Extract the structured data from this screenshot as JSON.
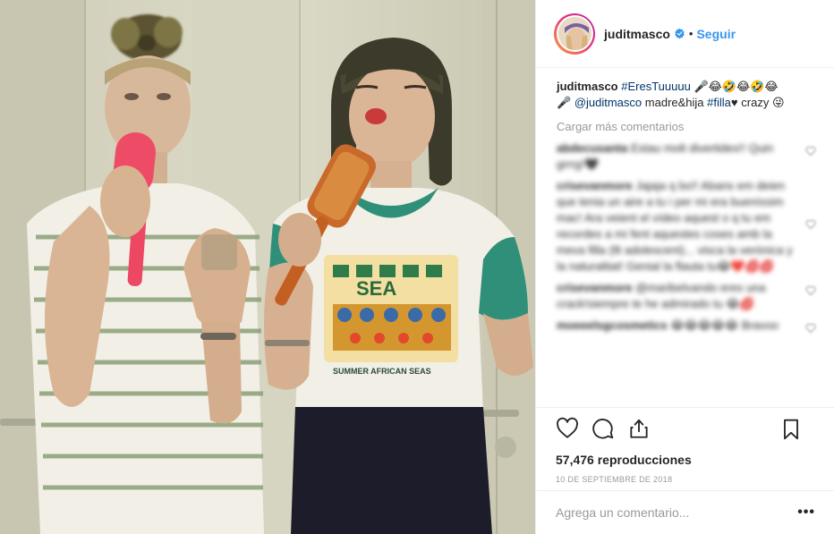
{
  "header": {
    "username": "juditmasco",
    "separator": "•",
    "follow_label": "Seguir",
    "verified_icon": "verified-badge-icon",
    "accent_color": "#3897f0"
  },
  "caption": {
    "username": "juditmasco",
    "hashtag1": "#EresTuuuuu",
    "emojis1": "🎤😂🤣😂🤣😂",
    "mic": "🎤",
    "mention": "@juditmasco",
    "text": "madre&hija",
    "hashtag2": "#filla",
    "heart": "♥",
    "tail": "crazy",
    "emoji_end": "😜"
  },
  "load_more": "Cargar más comentarios",
  "blurred_comments": [
    {
      "user": "abdecusanta",
      "text": "Estau molt divertides!! Quin grrrg!🖤"
    },
    {
      "user": "crisevanmore",
      "text": "Jajaja q bo!! Abans em deien que tenia un aire a tu i per mi era bueníssim mac! Ara veient el vídeo aquest o q tu em recordes a mi fent aquestes coses amb la meva filla (llt adolescent)... visca la verònica y la naturalitat! Genial la flauta tu😂❤️💋💋"
    },
    {
      "user": "crisevanmore",
      "text": "@maribelvando eres una crack!siempre te he admirado tu 😂💋"
    },
    {
      "user": "moeeelsgcosmetics",
      "text": "😂😂😂😂😂 Bravoo"
    }
  ],
  "actions": {
    "like_icon": "heart-icon",
    "comment_icon": "comment-bubble-icon",
    "share_icon": "share-icon",
    "save_icon": "bookmark-icon"
  },
  "views": "57,476 reproducciones",
  "date": "10 DE SEPTIEMBRE DE 2018",
  "add_comment": {
    "placeholder": "Agrega un comentario...",
    "more_label": "•••"
  },
  "media": {
    "shirt_text_top": "SEA",
    "shirt_text_bottom": "SUMMER AFRICAN SEAS"
  }
}
